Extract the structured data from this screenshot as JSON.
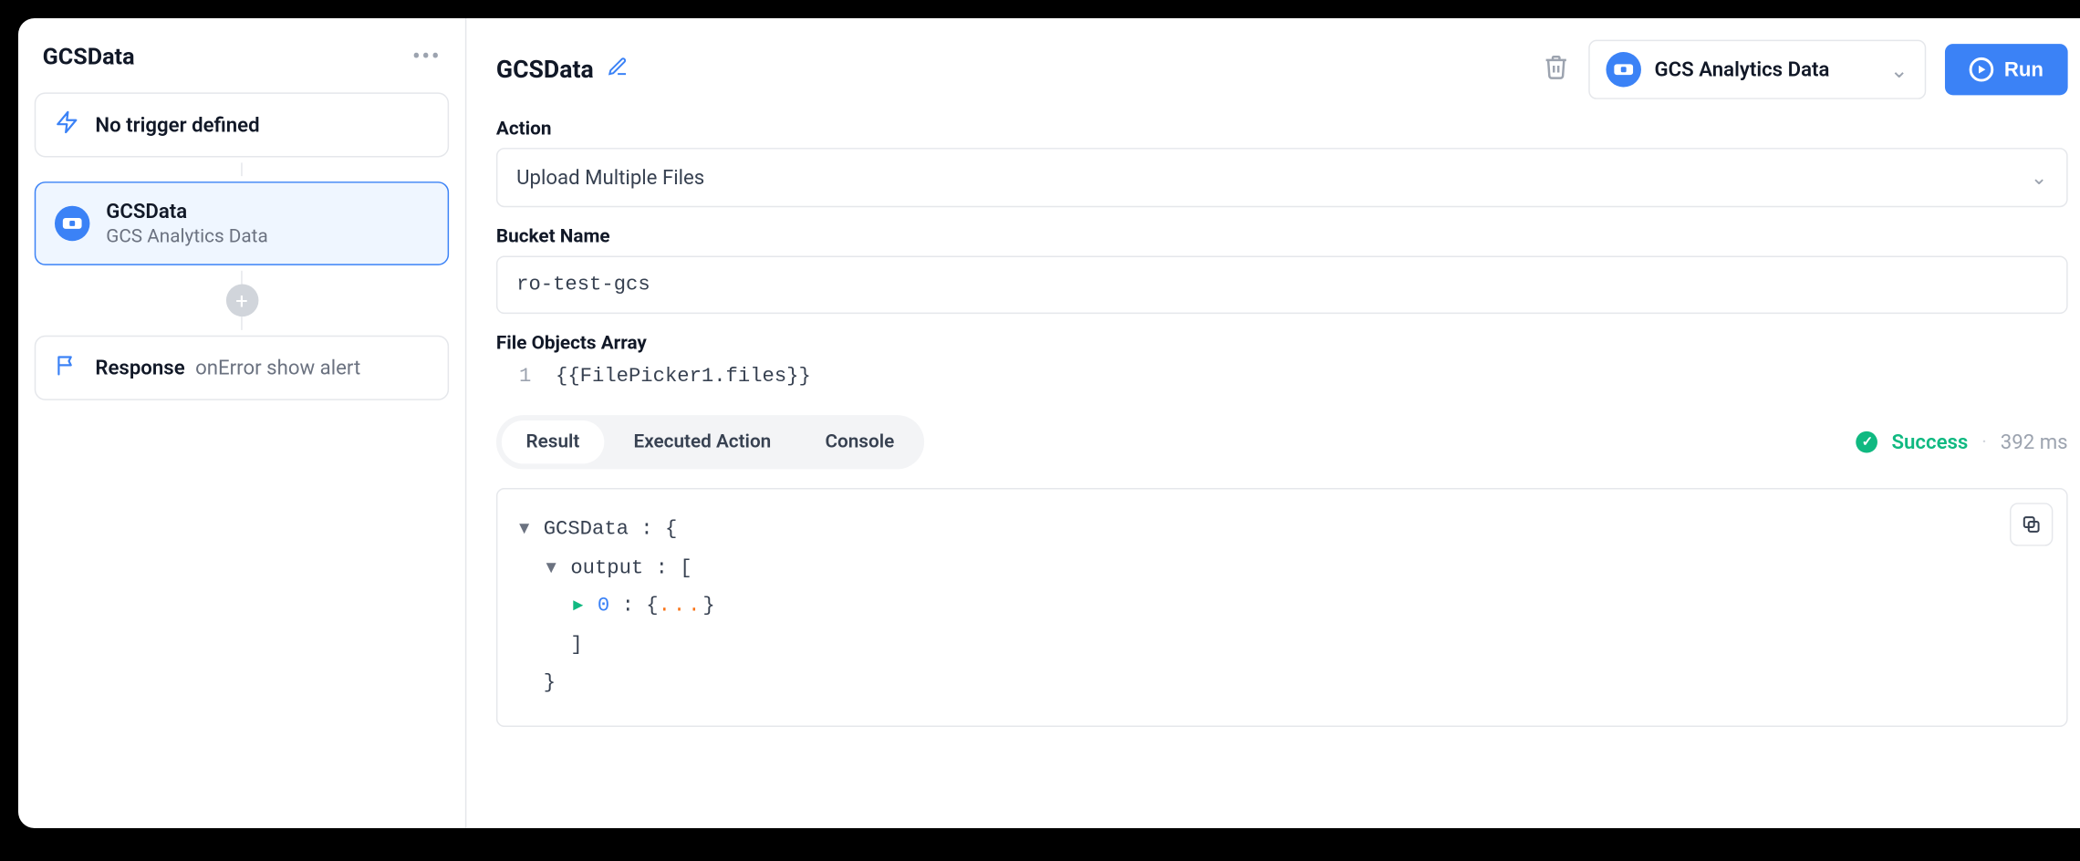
{
  "sidebar": {
    "title": "GCSData",
    "trigger_card": {
      "label": "No trigger defined"
    },
    "query_card": {
      "name": "GCSData",
      "datasource": "GCS Analytics Data"
    },
    "response_card": {
      "label": "Response",
      "detail": "onError show alert"
    }
  },
  "main": {
    "title": "GCSData",
    "datasource_dropdown": "GCS Analytics Data",
    "run_label": "Run",
    "action": {
      "label": "Action",
      "value": "Upload Multiple Files"
    },
    "bucket": {
      "label": "Bucket Name",
      "value": "ro-test-gcs"
    },
    "file_objects": {
      "label": "File Objects Array",
      "line_no": "1",
      "code": "{{FilePicker1.files}}"
    },
    "tabs": [
      "Result",
      "Executed Action",
      "Console"
    ],
    "active_tab": 0,
    "status": {
      "text": "Success",
      "time": "392 ms"
    },
    "result": {
      "root_key": "GCSData",
      "output_key": "output",
      "index_key": "0"
    }
  }
}
